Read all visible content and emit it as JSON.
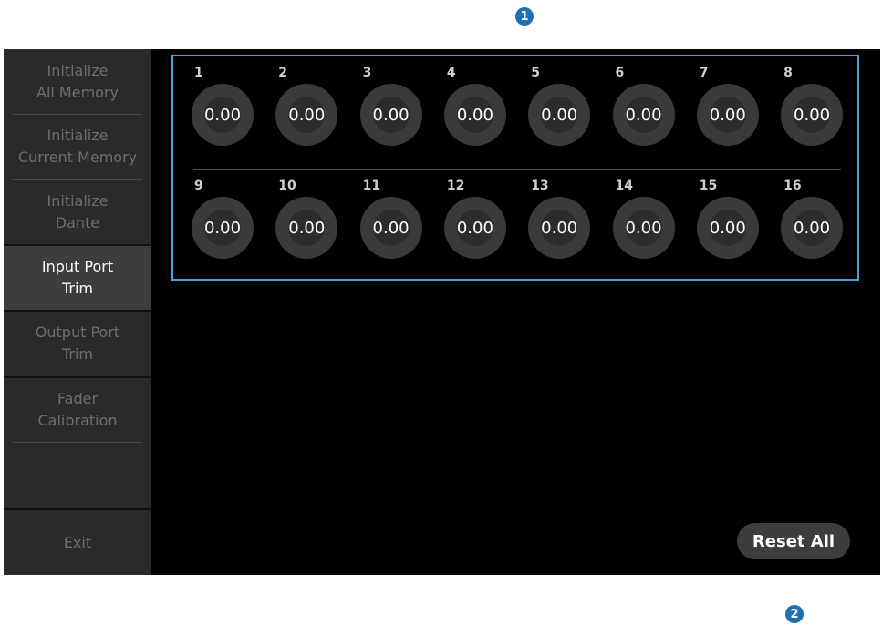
{
  "sidebar": {
    "items": [
      {
        "line1": "Initialize",
        "line2": "All Memory"
      },
      {
        "line1": "Initialize",
        "line2": "Current Memory"
      },
      {
        "line1": "Initialize",
        "line2": "Dante"
      },
      {
        "line1": "Input Port",
        "line2": "Trim"
      },
      {
        "line1": "Output Port",
        "line2": "Trim"
      },
      {
        "line1": "Fader",
        "line2": "Calibration"
      }
    ],
    "exit_label": "Exit"
  },
  "knobs": [
    {
      "num": "1",
      "value": "0.00"
    },
    {
      "num": "2",
      "value": "0.00"
    },
    {
      "num": "3",
      "value": "0.00"
    },
    {
      "num": "4",
      "value": "0.00"
    },
    {
      "num": "5",
      "value": "0.00"
    },
    {
      "num": "6",
      "value": "0.00"
    },
    {
      "num": "7",
      "value": "0.00"
    },
    {
      "num": "8",
      "value": "0.00"
    },
    {
      "num": "9",
      "value": "0.00"
    },
    {
      "num": "10",
      "value": "0.00"
    },
    {
      "num": "11",
      "value": "0.00"
    },
    {
      "num": "12",
      "value": "0.00"
    },
    {
      "num": "13",
      "value": "0.00"
    },
    {
      "num": "14",
      "value": "0.00"
    },
    {
      "num": "15",
      "value": "0.00"
    },
    {
      "num": "16",
      "value": "0.00"
    }
  ],
  "reset_label": "Reset All",
  "callouts": {
    "one": "1",
    "two": "2"
  },
  "colors": {
    "accent": "#4ea1d8",
    "callout": "#1f6fb5"
  }
}
